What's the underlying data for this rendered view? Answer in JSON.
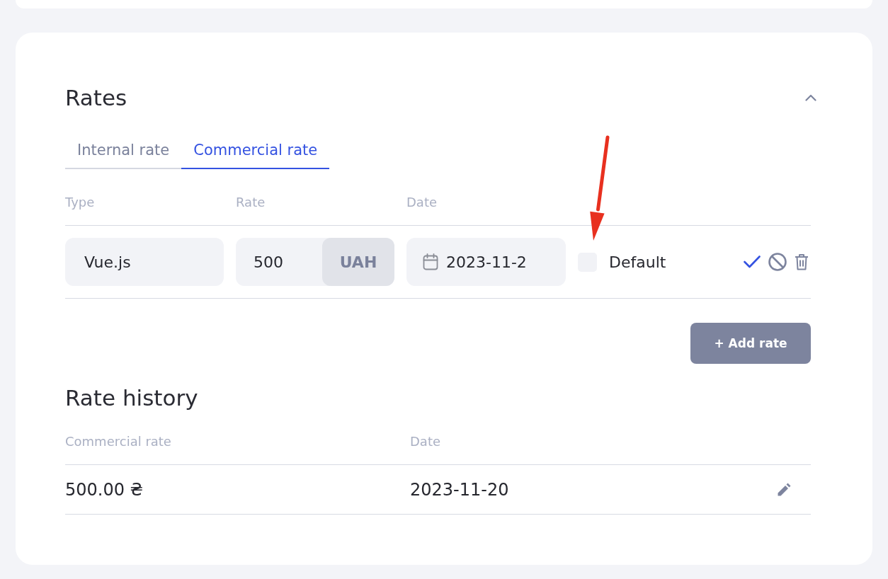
{
  "section": {
    "title": "Rates",
    "expanded": true
  },
  "tabs": [
    {
      "label": "Internal rate",
      "selected": false
    },
    {
      "label": "Commercial rate",
      "selected": true
    }
  ],
  "rate_form": {
    "columns": [
      "Type",
      "Rate",
      "Date"
    ],
    "row": {
      "type": "Vue.js",
      "rate": "500",
      "currency": "UAH",
      "date": "2023-11-2",
      "default": {
        "label": "Default",
        "checked": false
      }
    }
  },
  "add_button": "+ Add rate",
  "history": {
    "title": "Rate history",
    "columns": [
      "Commercial rate",
      "Date"
    ],
    "rows": [
      {
        "rate": "500.00 ₴",
        "date": "2023-11-20"
      }
    ]
  }
}
